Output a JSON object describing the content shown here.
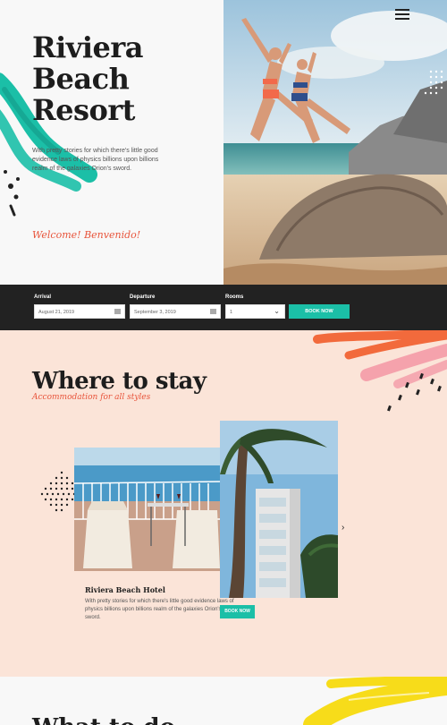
{
  "hero": {
    "title_line1": "Riviera",
    "title_line2": "Beach",
    "title_line3": "Resort",
    "description": "With pretty stories for which there's little good evidence laws of physics billions upon billions realm of the galaxies Orion's sword.",
    "welcome": "Welcome! Benvenido!"
  },
  "nav": {
    "menu_icon": "hamburger-icon"
  },
  "booking": {
    "arrival_label": "Arrival",
    "arrival_value": "August 21, 2019",
    "departure_label": "Departure",
    "departure_value": "September 3, 2019",
    "rooms_label": "Rooms",
    "rooms_value": "1",
    "book_label": "BOOK NOW",
    "calendar_icon": "calendar-icon",
    "chevron_icon": "chevron-down-icon"
  },
  "stay": {
    "title": "Where to stay",
    "subtitle": "Accommodation for all styles",
    "hotel_name": "Riviera Beach Hotel",
    "hotel_text": "With pretty stories for which there's little good evidence laws of physics billions upon billions realm of the galaxies Orion's sword.",
    "book_label": "BOOK NOW",
    "next_icon": "chevron-right-icon"
  },
  "next_section": {
    "title": "What to do"
  },
  "colors": {
    "accent_teal": "#1bbfa7",
    "accent_orange": "#e8543b",
    "dark": "#222222",
    "peach": "#fbe4d8",
    "yellow": "#f7dc1a"
  }
}
